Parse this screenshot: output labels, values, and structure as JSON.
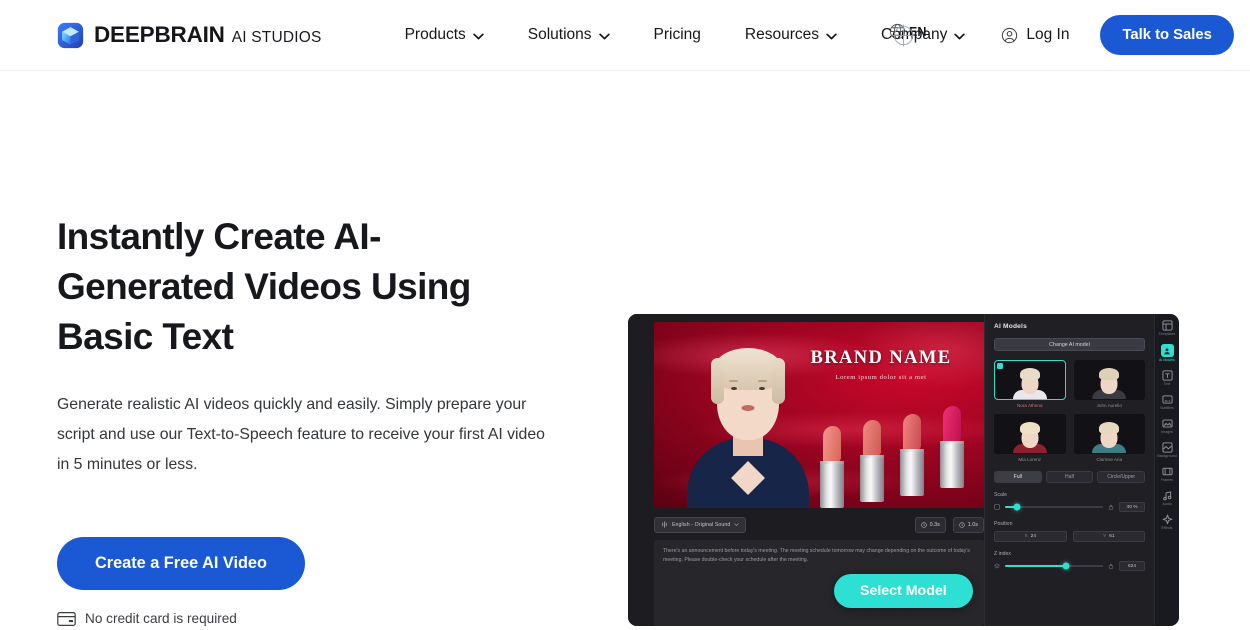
{
  "header": {
    "brand": {
      "name": "DEEPBRAIN",
      "suffix": "AI STUDIOS",
      "icon": "cube-logo-icon"
    },
    "nav": [
      {
        "label": "Products",
        "has_chevron": true
      },
      {
        "label": "Solutions",
        "has_chevron": true
      },
      {
        "label": "Pricing",
        "has_chevron": false
      },
      {
        "label": "Resources",
        "has_chevron": true
      },
      {
        "label": "Company",
        "has_chevron": true
      }
    ],
    "language": {
      "label": "EN",
      "icon": "globe-icon"
    },
    "login": {
      "label": "Log In",
      "icon": "user-circle-icon"
    },
    "cta": {
      "label": "Talk to Sales"
    }
  },
  "hero": {
    "headline": "Instantly Create AI-Generated Videos Using Basic Text",
    "subheadline": "Generate realistic AI videos quickly and easily. Simply prepare your script and use our Text-to-Speech feature to receive your first AI video in 5 minutes or less.",
    "cta_label": "Create a Free AI Video",
    "note": {
      "label": "No credit card is required",
      "icon": "credit-card-icon"
    }
  },
  "editor": {
    "scene": {
      "brand_title": "BRAND NAME",
      "brand_tagline": "Lorem ipsum dolor sit a met"
    },
    "toolbar": {
      "language_label": "English - Original Sound",
      "chips": [
        {
          "label": "0.3s",
          "icon": "clock-icon"
        },
        {
          "label": "1.0s",
          "icon": "clock-icon"
        }
      ]
    },
    "script": "There's an announcement before today's meeting. The meeting schedule tomorrow may change depending on the outcome of today's meeting. Please double-check your schedule after the meeting.",
    "panel": {
      "title": "AI Models",
      "change_button": "Change AI model",
      "models": [
        {
          "name": "Nora Athena",
          "selected": true,
          "hair": "#e8dcc8",
          "outfit": "#e8e8ec"
        },
        {
          "name": "John Aurelio",
          "selected": false,
          "hair": "#ded0b6",
          "outfit": "#3a3a42"
        },
        {
          "name": "Mia Lorenz",
          "selected": false,
          "hair": "#efe0c6",
          "outfit": "#8e1f2e"
        },
        {
          "name": "Clarisse Aria",
          "selected": false,
          "hair": "#e6d9c0",
          "outfit": "#3f7d86"
        }
      ],
      "segments": [
        {
          "label": "Full",
          "active": true
        },
        {
          "label": "Half",
          "active": false
        },
        {
          "label": "Circle/Upper",
          "active": false
        }
      ],
      "properties": {
        "scale": {
          "label": "Scale",
          "value": "40 %",
          "percent": 12
        },
        "position": {
          "label": "Position",
          "x_axis": "X",
          "x_value": "24",
          "y_axis": "Y",
          "y_value": "61"
        },
        "z_index": {
          "label": "Z index",
          "value": "624",
          "percent": 62
        }
      }
    },
    "rail": [
      {
        "label": "Templates",
        "icon": "template-icon",
        "active": false
      },
      {
        "label": "AI Models",
        "icon": "ai-model-icon",
        "active": true
      },
      {
        "label": "Text",
        "icon": "text-box-icon",
        "active": false
      },
      {
        "label": "Subtitles",
        "icon": "subtitles-icon",
        "active": false
      },
      {
        "label": "Images",
        "icon": "image-icon",
        "active": false
      },
      {
        "label": "Background",
        "icon": "background-icon",
        "active": false
      },
      {
        "label": "Frames",
        "icon": "frames-icon",
        "active": false
      },
      {
        "label": "Audio",
        "icon": "audio-icon",
        "active": false
      },
      {
        "label": "Effects",
        "icon": "effects-icon",
        "active": false
      }
    ],
    "select_model_button": "Select Model"
  }
}
